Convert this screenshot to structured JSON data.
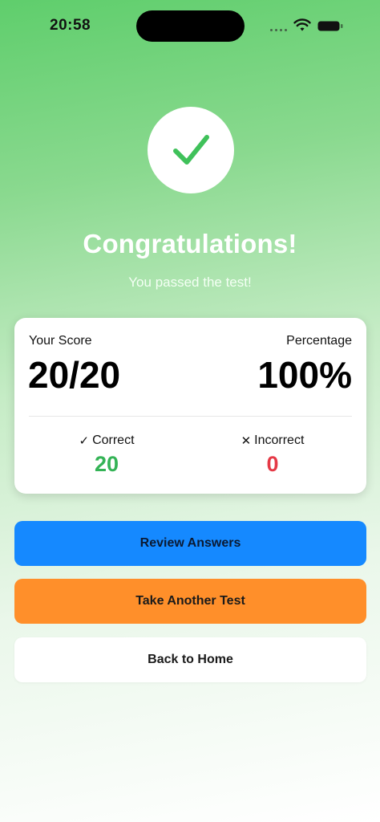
{
  "status_bar": {
    "time": "20:58"
  },
  "result": {
    "title": "Congratulations!",
    "subtitle": "You passed the test!",
    "icon": "checkmark-icon"
  },
  "score_card": {
    "score_label": "Your Score",
    "score_value": "20/20",
    "percentage_label": "Percentage",
    "percentage_value": "100%",
    "correct_label": "Correct",
    "correct_value": "20",
    "incorrect_label": "Incorrect",
    "incorrect_value": "0"
  },
  "actions": {
    "review_label": "Review Answers",
    "another_label": "Take Another Test",
    "home_label": "Back to Home"
  },
  "colors": {
    "success_green": "#34b356",
    "error_red": "#e53946",
    "review_blue": "#1589ff",
    "another_orange": "#ff8f2a"
  }
}
